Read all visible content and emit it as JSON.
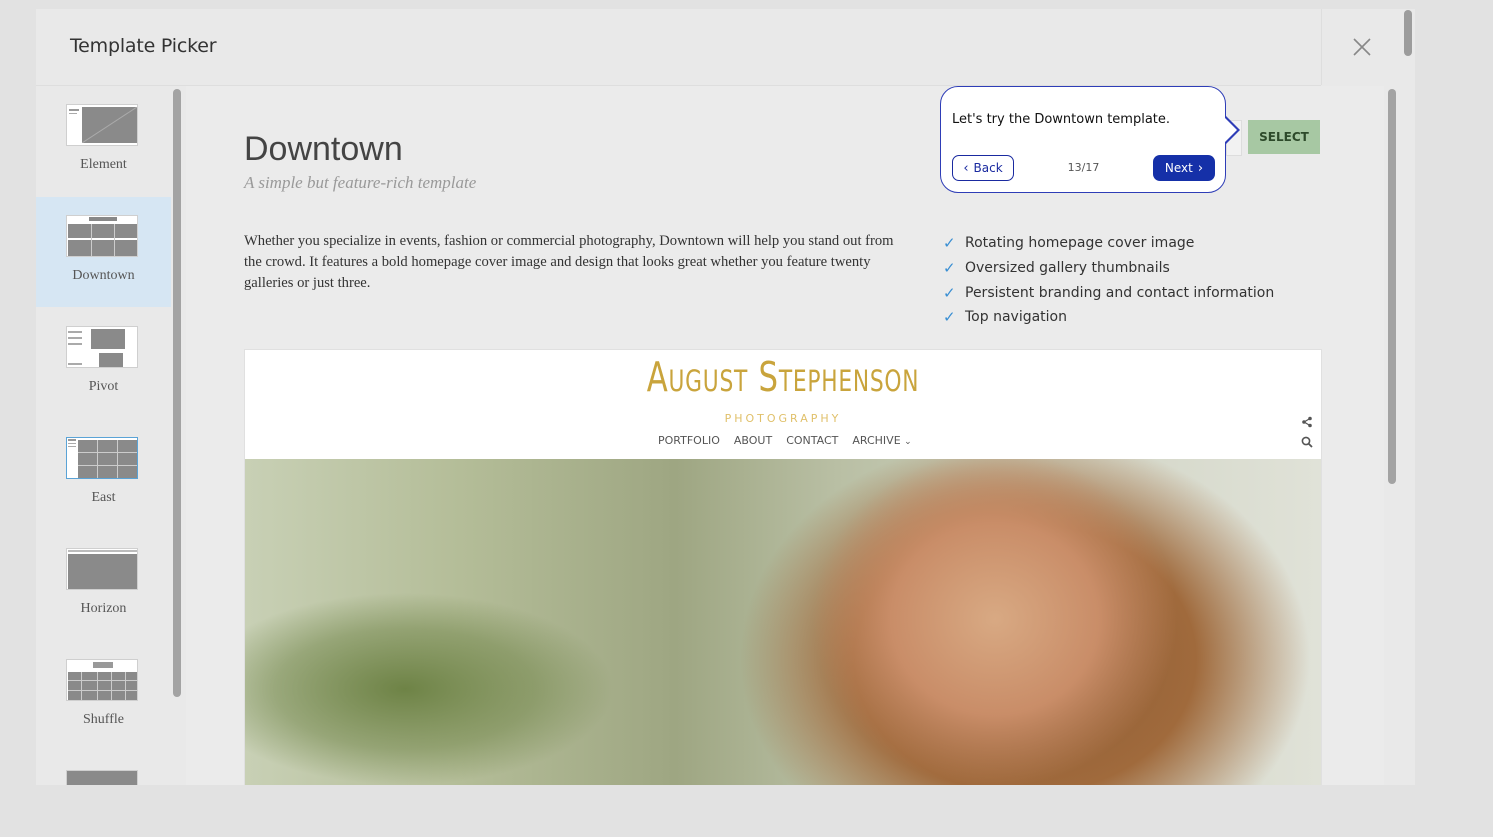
{
  "modal": {
    "title": "Template Picker",
    "close_icon": "close-icon"
  },
  "sidebar": {
    "items": [
      {
        "label": "Element",
        "active": false
      },
      {
        "label": "Downtown",
        "active": true
      },
      {
        "label": "Pivot",
        "active": false
      },
      {
        "label": "East",
        "active": false
      },
      {
        "label": "Horizon",
        "active": false
      },
      {
        "label": "Shuffle",
        "active": false
      },
      {
        "label": "",
        "active": false
      }
    ]
  },
  "template": {
    "name": "Downtown",
    "tagline": "A simple but feature-rich template",
    "description": "Whether you specialize in events, fashion or commercial photography, Downtown will help you stand out from the crowd. It features a bold homepage cover image and design that looks great whether you feature twenty galleries or just three.",
    "features": [
      "Rotating homepage cover image",
      "Oversized gallery thumbnails",
      "Persistent branding and contact information",
      "Top navigation"
    ],
    "select_label": "SELECT"
  },
  "preview": {
    "brand_name": "August Stephenson",
    "brand_sub": "PHOTOGRAPHY",
    "nav": [
      "PORTFOLIO",
      "ABOUT",
      "CONTACT",
      "ARCHIVE"
    ]
  },
  "tour": {
    "message": "Let's try the Downtown template.",
    "back_label": "Back",
    "next_label": "Next",
    "progress": "13/17"
  },
  "colors": {
    "accent_select": "#a7c8a3",
    "tour_primary": "#1530a8",
    "brand_gold": "#c9a43c",
    "active_sidebar": "#d6e6f3"
  }
}
